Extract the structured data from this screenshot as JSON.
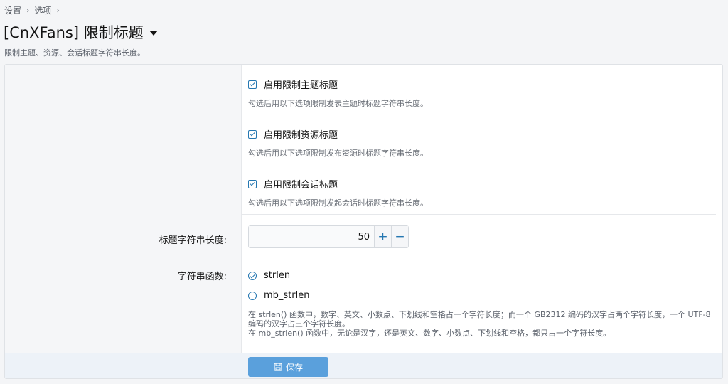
{
  "breadcrumb": {
    "items": [
      "设置",
      "选项"
    ],
    "separator": "›"
  },
  "page": {
    "title": "[CnXFans] 限制标题",
    "description": "限制主题、资源、会话标题字符串长度。"
  },
  "options": {
    "thread": {
      "label": "启用限制主题标题",
      "hint": "勾选后用以下选项限制发表主题时标题字符串长度。",
      "checked": true
    },
    "resource": {
      "label": "启用限制资源标题",
      "hint": "勾选后用以下选项限制发布资源时标题字符串长度。",
      "checked": true
    },
    "conversation": {
      "label": "启用限制会话标题",
      "hint": "勾选后用以下选项限制发起会话时标题字符串长度。",
      "checked": true
    }
  },
  "length_field": {
    "label": "标题字符串长度:",
    "value": "50",
    "plus": "+",
    "minus": "−"
  },
  "function_field": {
    "label": "字符串函数:",
    "options": [
      "strlen",
      "mb_strlen"
    ],
    "selected": "strlen",
    "explain_1": "在 strlen() 函数中，数字、英文、小数点、下划线和空格占一个字符长度；而一个 GB2312 编码的汉字占两个字符长度，一个 UTF-8 编码的汉字占三个字符长度。",
    "explain_2": "在 mb_strlen() 函数中，无论是汉字，还是英文、数字、小数点、下划线和空格，都只占一个字符长度。"
  },
  "footer": {
    "save_label": "保存"
  },
  "colors": {
    "accent": "#2577b1",
    "save_button": "#5aa0dc",
    "footer_bg": "#edf2f8"
  }
}
